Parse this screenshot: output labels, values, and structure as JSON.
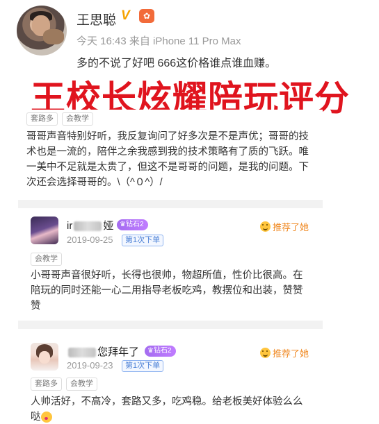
{
  "post": {
    "author": "王思聪",
    "verified_mark": "V",
    "meta": "今天 16:43 来自 iPhone 11 Pro Max",
    "text": "多的不说了好吧 666这价格谁点谁血赚。"
  },
  "overlay_title": "王校长炫耀陪玩评分",
  "reviews": [
    {
      "tags": [
        "套路多",
        "会教学"
      ],
      "text": "哥哥声音特别好听，我反复询问了好多次是不是声优；哥哥的技术也是一流的，陪伴之余我感到我的技术策略有了质的飞跃。唯一美中不足就是太贵了，但这不是哥哥的问题，是我的问题。下次还会选择哥哥的。\\（^０^）/"
    },
    {
      "name_prefix": "ir",
      "name_suffix": "娅",
      "level": "钻石2",
      "date": "2019-09-25",
      "order": "第1次下单",
      "recommend": "推荐了她",
      "tags": [
        "会教学"
      ],
      "text": "小哥哥声音很好听，长得也很帅，物超所值，性价比很高。在陪玩的同时还能一心二用指导老板吃鸡，教摆位和出装，赞赞赞"
    },
    {
      "name_prefix": "",
      "name_suffix": "您拜年了",
      "level": "钻石2",
      "date": "2019-09-23",
      "order": "第1次下单",
      "recommend": "推荐了她",
      "tags": [
        "套路多",
        "会教学"
      ],
      "text": "人帅活好，不高冷，套路又多，吃鸡稳。给老板美好体验么么哒"
    }
  ],
  "colors": {
    "title_red": "#e0141e",
    "level_purple": "#a46cf0",
    "recommend_orange": "#f08a24",
    "order_blue": "#4a7fd6"
  }
}
